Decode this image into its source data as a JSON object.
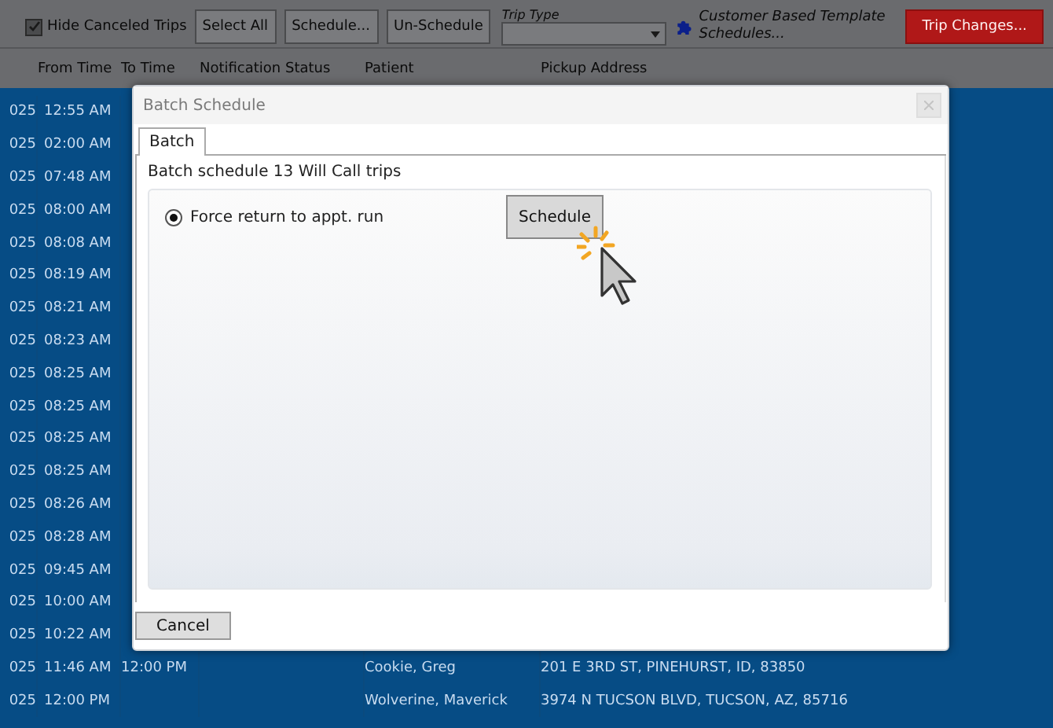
{
  "toolbar": {
    "hide_canceled": {
      "label": "Hide Canceled Trips",
      "checked": true
    },
    "buttons": [
      "Select All",
      "Schedule...",
      "Un-Schedule"
    ],
    "trip_type": {
      "label": "Trip Type"
    },
    "template_link": "Customer Based Template Schedules...",
    "trip_changes_button": "Trip Changes..."
  },
  "table": {
    "columns": [
      "From Time",
      "To Time",
      "Notification Status",
      "Patient",
      "Pickup Address"
    ],
    "rows": [
      {
        "date": "025",
        "from_time": "12:55 AM"
      },
      {
        "date": "025",
        "from_time": "02:00 AM"
      },
      {
        "date": "025",
        "from_time": "07:48 AM"
      },
      {
        "date": "025",
        "from_time": "08:00 AM"
      },
      {
        "date": "025",
        "from_time": "08:08 AM"
      },
      {
        "date": "025",
        "from_time": "08:19 AM"
      },
      {
        "date": "025",
        "from_time": "08:21 AM"
      },
      {
        "date": "025",
        "from_time": "08:23 AM"
      },
      {
        "date": "025",
        "from_time": "08:25 AM"
      },
      {
        "date": "025",
        "from_time": "08:25 AM"
      },
      {
        "date": "025",
        "from_time": "08:25 AM"
      },
      {
        "date": "025",
        "from_time": "08:25 AM"
      },
      {
        "date": "025",
        "from_time": "08:26 AM"
      },
      {
        "date": "025",
        "from_time": "08:28 AM"
      },
      {
        "date": "025",
        "from_time": "09:45 AM"
      },
      {
        "date": "025",
        "from_time": "10:00 AM"
      },
      {
        "date": "025",
        "from_time": "10:22 AM"
      },
      {
        "date": "025",
        "from_time": "11:46 AM",
        "to_time": "12:00 PM",
        "patient": "Cookie, Greg",
        "pickup_address": "201 E 3RD ST, PINEHURST, ID, 83850"
      },
      {
        "date": "025",
        "from_time": "12:00 PM",
        "patient": "Wolverine, Maverick",
        "pickup_address": "3974 N TUCSON BLVD, TUCSON, AZ, 85716"
      }
    ]
  },
  "dialog": {
    "title": "Batch Schedule",
    "tabs": [
      {
        "label": "Batch",
        "selected": true
      }
    ],
    "summary": "Batch schedule 13 Will Call trips",
    "options": [
      {
        "label": "Force return to appt. run",
        "selected": true
      }
    ],
    "schedule_button": "Schedule",
    "cancel_button": "Cancel"
  }
}
